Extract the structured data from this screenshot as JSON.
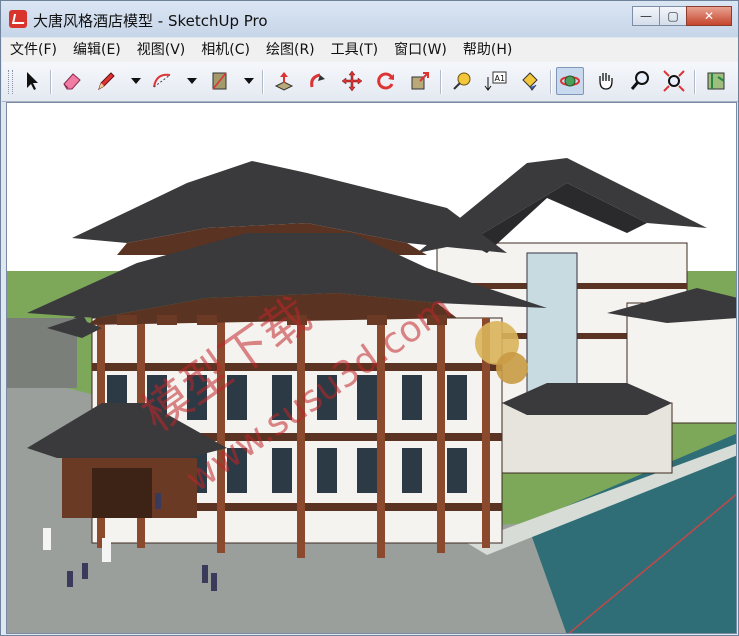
{
  "window": {
    "title": "大唐风格酒店模型 - SketchUp Pro"
  },
  "window_controls": {
    "minimize": "—",
    "maximize": "▢",
    "close": "✕"
  },
  "menu": [
    {
      "label": "文件(F)"
    },
    {
      "label": "编辑(E)"
    },
    {
      "label": "视图(V)"
    },
    {
      "label": "相机(C)"
    },
    {
      "label": "绘图(R)"
    },
    {
      "label": "工具(T)"
    },
    {
      "label": "窗口(W)"
    },
    {
      "label": "帮助(H)"
    }
  ],
  "toolbar": {
    "tools": [
      "select",
      "eraser",
      "pencil",
      "arc",
      "rectangle",
      "push-pull",
      "follow-me",
      "move",
      "rotate",
      "scale",
      "tape-measure",
      "dimension",
      "paint-bucket",
      "orbit",
      "pan",
      "zoom",
      "zoom-extents",
      "components"
    ],
    "active_tool": "orbit",
    "dimension_text": "A1"
  },
  "viewport": {
    "watermark": "模型下载",
    "watermark2": "www.susu3d.com",
    "colors": {
      "sky": "#ffffff",
      "ground": "#7da85a",
      "roof": "#3a3a3c",
      "wood": "#8b4a2e",
      "wall": "#f5f3ef",
      "water": "#2f6e77"
    }
  }
}
